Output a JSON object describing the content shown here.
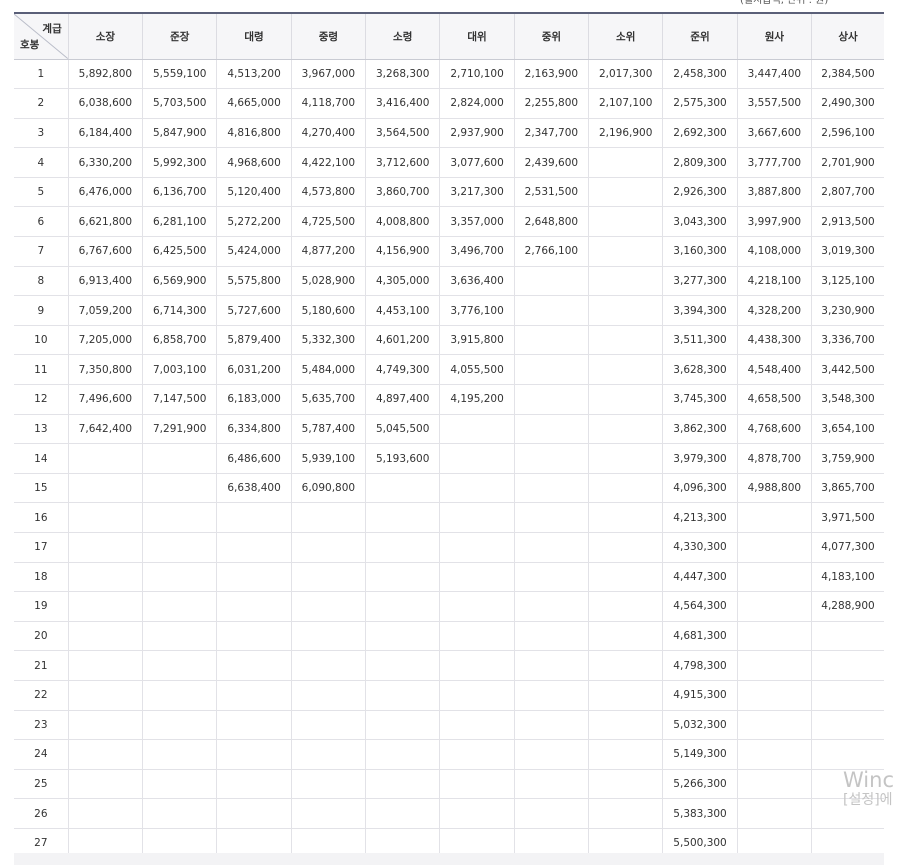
{
  "unit_note": "(월지급액, 단위 : 원)",
  "header": {
    "corner_top": "계급",
    "corner_bottom": "호봉",
    "ranks": [
      "소장",
      "준장",
      "대령",
      "중령",
      "소령",
      "대위",
      "중위",
      "소위",
      "준위",
      "원사",
      "상사"
    ]
  },
  "rows": [
    [
      "1",
      "5,892,800",
      "5,559,100",
      "4,513,200",
      "3,967,000",
      "3,268,300",
      "2,710,100",
      "2,163,900",
      "2,017,300",
      "2,458,300",
      "3,447,400",
      "2,384,500"
    ],
    [
      "2",
      "6,038,600",
      "5,703,500",
      "4,665,000",
      "4,118,700",
      "3,416,400",
      "2,824,000",
      "2,255,800",
      "2,107,100",
      "2,575,300",
      "3,557,500",
      "2,490,300"
    ],
    [
      "3",
      "6,184,400",
      "5,847,900",
      "4,816,800",
      "4,270,400",
      "3,564,500",
      "2,937,900",
      "2,347,700",
      "2,196,900",
      "2,692,300",
      "3,667,600",
      "2,596,100"
    ],
    [
      "4",
      "6,330,200",
      "5,992,300",
      "4,968,600",
      "4,422,100",
      "3,712,600",
      "3,077,600",
      "2,439,600",
      "",
      "2,809,300",
      "3,777,700",
      "2,701,900"
    ],
    [
      "5",
      "6,476,000",
      "6,136,700",
      "5,120,400",
      "4,573,800",
      "3,860,700",
      "3,217,300",
      "2,531,500",
      "",
      "2,926,300",
      "3,887,800",
      "2,807,700"
    ],
    [
      "6",
      "6,621,800",
      "6,281,100",
      "5,272,200",
      "4,725,500",
      "4,008,800",
      "3,357,000",
      "2,648,800",
      "",
      "3,043,300",
      "3,997,900",
      "2,913,500"
    ],
    [
      "7",
      "6,767,600",
      "6,425,500",
      "5,424,000",
      "4,877,200",
      "4,156,900",
      "3,496,700",
      "2,766,100",
      "",
      "3,160,300",
      "4,108,000",
      "3,019,300"
    ],
    [
      "8",
      "6,913,400",
      "6,569,900",
      "5,575,800",
      "5,028,900",
      "4,305,000",
      "3,636,400",
      "",
      "",
      "3,277,300",
      "4,218,100",
      "3,125,100"
    ],
    [
      "9",
      "7,059,200",
      "6,714,300",
      "5,727,600",
      "5,180,600",
      "4,453,100",
      "3,776,100",
      "",
      "",
      "3,394,300",
      "4,328,200",
      "3,230,900"
    ],
    [
      "10",
      "7,205,000",
      "6,858,700",
      "5,879,400",
      "5,332,300",
      "4,601,200",
      "3,915,800",
      "",
      "",
      "3,511,300",
      "4,438,300",
      "3,336,700"
    ],
    [
      "11",
      "7,350,800",
      "7,003,100",
      "6,031,200",
      "5,484,000",
      "4,749,300",
      "4,055,500",
      "",
      "",
      "3,628,300",
      "4,548,400",
      "3,442,500"
    ],
    [
      "12",
      "7,496,600",
      "7,147,500",
      "6,183,000",
      "5,635,700",
      "4,897,400",
      "4,195,200",
      "",
      "",
      "3,745,300",
      "4,658,500",
      "3,548,300"
    ],
    [
      "13",
      "7,642,400",
      "7,291,900",
      "6,334,800",
      "5,787,400",
      "5,045,500",
      "",
      "",
      "",
      "3,862,300",
      "4,768,600",
      "3,654,100"
    ],
    [
      "14",
      "",
      "",
      "6,486,600",
      "5,939,100",
      "5,193,600",
      "",
      "",
      "",
      "3,979,300",
      "4,878,700",
      "3,759,900"
    ],
    [
      "15",
      "",
      "",
      "6,638,400",
      "6,090,800",
      "",
      "",
      "",
      "",
      "4,096,300",
      "4,988,800",
      "3,865,700"
    ],
    [
      "16",
      "",
      "",
      "",
      "",
      "",
      "",
      "",
      "",
      "4,213,300",
      "",
      "3,971,500"
    ],
    [
      "17",
      "",
      "",
      "",
      "",
      "",
      "",
      "",
      "",
      "4,330,300",
      "",
      "4,077,300"
    ],
    [
      "18",
      "",
      "",
      "",
      "",
      "",
      "",
      "",
      "",
      "4,447,300",
      "",
      "4,183,100"
    ],
    [
      "19",
      "",
      "",
      "",
      "",
      "",
      "",
      "",
      "",
      "4,564,300",
      "",
      "4,288,900"
    ],
    [
      "20",
      "",
      "",
      "",
      "",
      "",
      "",
      "",
      "",
      "4,681,300",
      "",
      ""
    ],
    [
      "21",
      "",
      "",
      "",
      "",
      "",
      "",
      "",
      "",
      "4,798,300",
      "",
      ""
    ],
    [
      "22",
      "",
      "",
      "",
      "",
      "",
      "",
      "",
      "",
      "4,915,300",
      "",
      ""
    ],
    [
      "23",
      "",
      "",
      "",
      "",
      "",
      "",
      "",
      "",
      "5,032,300",
      "",
      ""
    ],
    [
      "24",
      "",
      "",
      "",
      "",
      "",
      "",
      "",
      "",
      "5,149,300",
      "",
      ""
    ],
    [
      "25",
      "",
      "",
      "",
      "",
      "",
      "",
      "",
      "",
      "5,266,300",
      "",
      ""
    ],
    [
      "26",
      "",
      "",
      "",
      "",
      "",
      "",
      "",
      "",
      "5,383,300",
      "",
      ""
    ],
    [
      "27",
      "",
      "",
      "",
      "",
      "",
      "",
      "",
      "",
      "5,500,300",
      "",
      ""
    ]
  ],
  "watermark": {
    "line1": "Winc",
    "line2": "[설정]에"
  }
}
